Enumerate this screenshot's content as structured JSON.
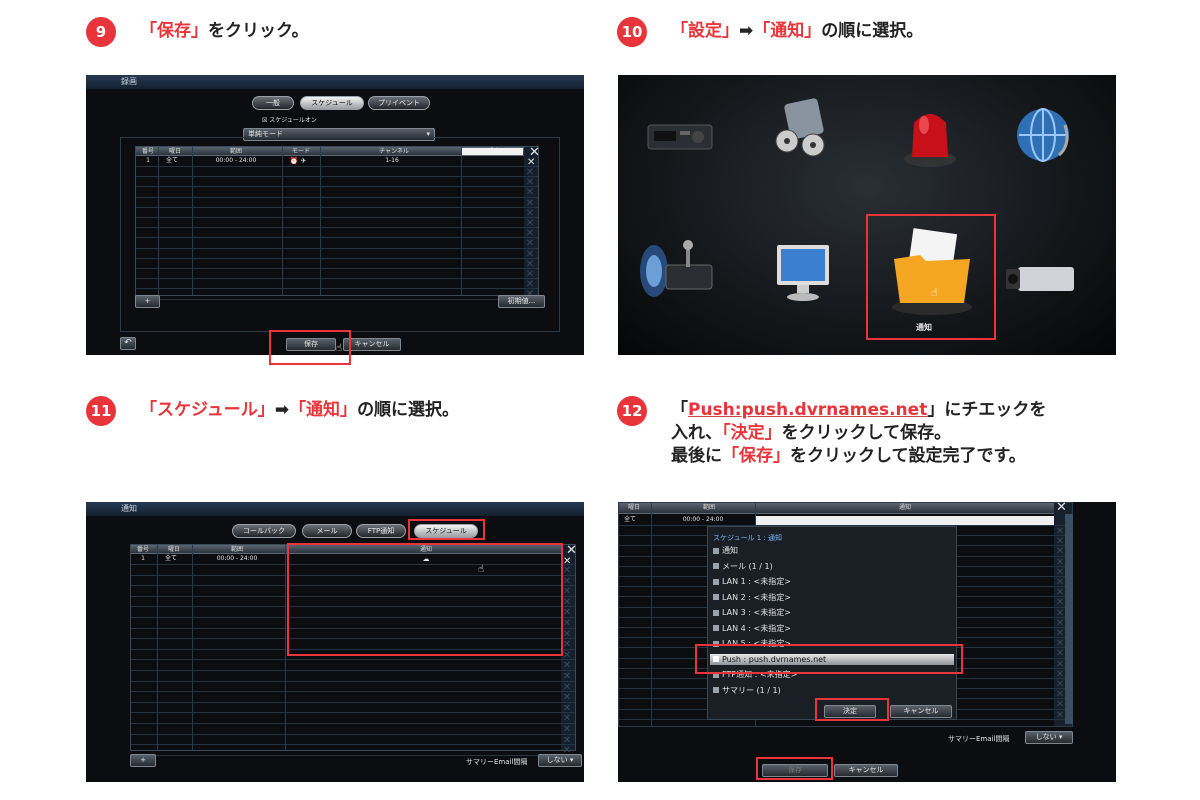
{
  "steps": [
    {
      "num": "9",
      "title": [
        {
          "t": "「保存」",
          "r": true
        },
        {
          "t": "をクリック。"
        }
      ]
    },
    {
      "num": "10",
      "title": [
        {
          "t": "「設定」",
          "r": true
        },
        {
          "t": "➡"
        },
        {
          "t": "「通知」",
          "r": true
        },
        {
          "t": "の順に選択。"
        }
      ]
    },
    {
      "num": "11",
      "title": [
        {
          "t": "「スケジュール」",
          "r": true
        },
        {
          "t": "➡"
        },
        {
          "t": "「通知」",
          "r": true
        },
        {
          "t": "の順に選択。"
        }
      ]
    },
    {
      "num": "12",
      "lines": [
        [
          {
            "t": "「"
          },
          {
            "t": "Push:push.dvrnames.net",
            "r": true,
            "u": true
          },
          {
            "t": "」にチエックを"
          }
        ],
        [
          {
            "t": " 入れ、"
          },
          {
            "t": "「決定」",
            "r": true
          },
          {
            "t": "をクリックして保存。"
          }
        ],
        [
          {
            "t": " 最後に"
          },
          {
            "t": "「保存」",
            "r": true
          },
          {
            "t": "をクリックして設定完了です。"
          }
        ]
      ]
    }
  ],
  "shot1": {
    "title": "録画",
    "tabs": [
      "一般",
      "スケジュール",
      "プリイベント"
    ],
    "schedule_on": "スケジュールオン",
    "mode_select": "単純モード",
    "headers": [
      "番号",
      "曜日",
      "範囲",
      "モード",
      "チャンネル",
      "設定"
    ],
    "row": {
      "no": "1",
      "day": "全て",
      "range": "00:00 - 24:00",
      "channel": "1-16"
    },
    "add_btn": "+",
    "init_btn": "初期値...",
    "save_btn": "保存",
    "cancel_btn": "キャンセル"
  },
  "shot2": {
    "notify_label": "通知"
  },
  "shot3": {
    "title": "通知",
    "tabs": [
      "コールバック",
      "メール",
      "FTP通知",
      "スケジュール"
    ],
    "headers": [
      "番号",
      "曜日",
      "範囲",
      "通知"
    ],
    "row": {
      "no": "1",
      "day": "全て",
      "range": "00:00 - 24:00"
    },
    "add_btn": "+",
    "summary_label": "サマリーEmail間隔",
    "summary_value": "しない"
  },
  "shot4": {
    "headers": [
      "曜日",
      "範囲",
      "通知"
    ],
    "row": {
      "day": "全て",
      "range": "00:00 - 24:00"
    },
    "popup_title": "スケジュール 1 : 通知",
    "items": [
      "通知",
      "メール (1 / 1)",
      "LAN 1 : <未指定>",
      "LAN 2 : <未指定>",
      "LAN 3 : <未指定>",
      "LAN 4 : <未指定>",
      "LAN 5 : <未指定>",
      "Push : push.dvrnames.net",
      "FTP通知 : <未指定>",
      "サマリー (1 / 1)"
    ],
    "ok_btn": "決定",
    "cancel_btn": "キャンセル",
    "summary_label": "サマリーEmail間隔",
    "summary_value": "しない",
    "save_btn": "保存",
    "cancel_btn2": "キャンセル"
  }
}
